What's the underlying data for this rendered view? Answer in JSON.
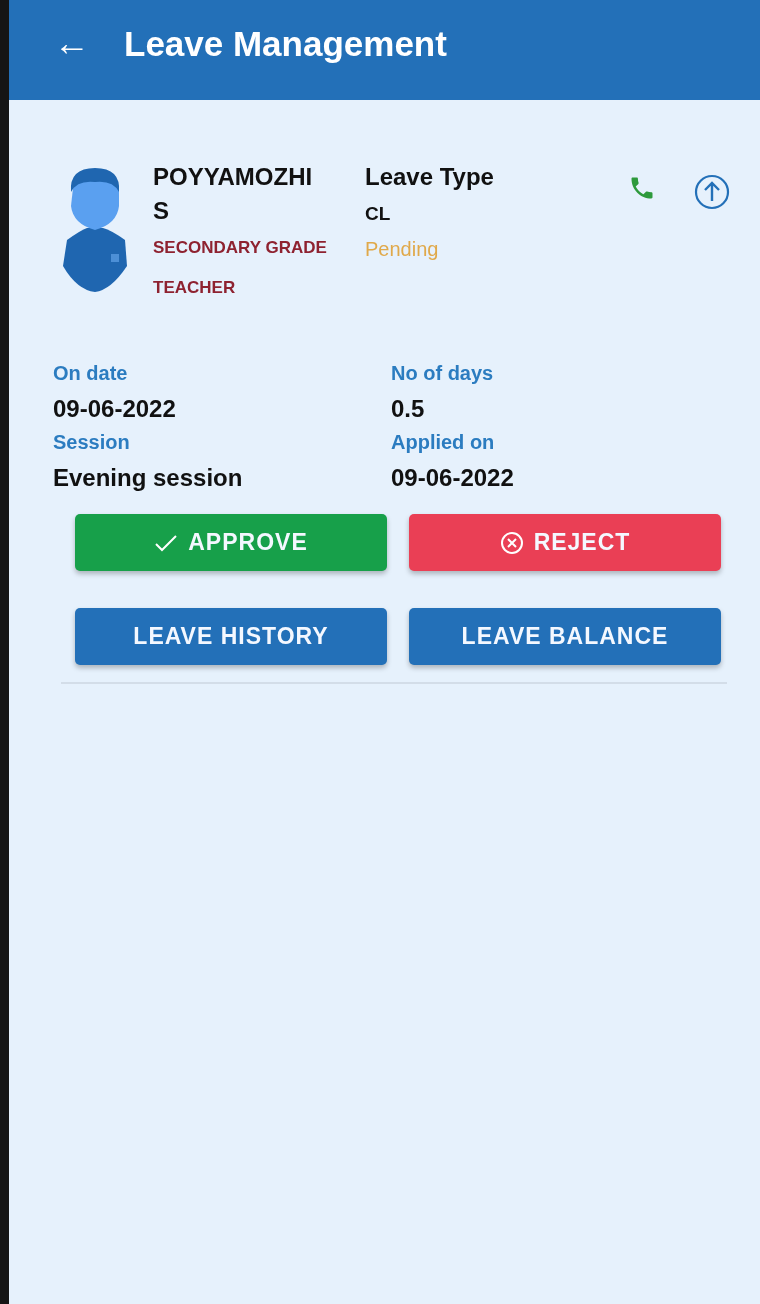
{
  "header": {
    "back_icon": "←",
    "title": "Leave Management"
  },
  "request": {
    "name": "POYYAMOZHI S",
    "designation": "SECONDARY GRADE TEACHER",
    "leave_type_label": "Leave Type",
    "leave_type": "CL",
    "status": "Pending",
    "details": [
      {
        "label": "On date",
        "value": "09-06-2022"
      },
      {
        "label": "No of days",
        "value": "0.5"
      },
      {
        "label": "Session",
        "value": "Evening session"
      },
      {
        "label": "Applied on",
        "value": "09-06-2022"
      }
    ],
    "buttons": [
      {
        "kind": "approve",
        "label": "APPROVE"
      },
      {
        "kind": "reject",
        "label": "REJECT"
      },
      {
        "kind": "primary",
        "label": "LEAVE HISTORY"
      },
      {
        "kind": "primary",
        "label": "LEAVE BALANCE"
      }
    ]
  }
}
